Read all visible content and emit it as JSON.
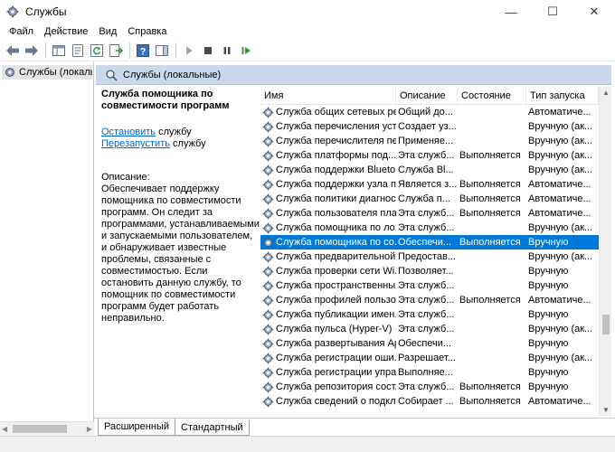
{
  "window": {
    "title": "Службы",
    "minimize_glyph": "—",
    "maximize_glyph": "☐",
    "close_glyph": "✕"
  },
  "menu": [
    "Файл",
    "Действие",
    "Вид",
    "Справка"
  ],
  "toolbar": {
    "icons": [
      "back-arrow-icon",
      "forward-arrow-icon",
      "console-tree-icon",
      "properties-icon",
      "refresh-icon",
      "export-list-icon",
      "help-icon",
      "show-hide-pane-icon",
      "play-icon",
      "stop-icon",
      "pause-icon",
      "restart-icon"
    ]
  },
  "tree": {
    "item_label": "Службы (локальны"
  },
  "panel": {
    "header": "Службы (локальные)",
    "selected_title": "Служба помощника по совместимости программ",
    "link_stop": "Остановить",
    "link_stop_suffix": " службу",
    "link_restart": "Перезапустить",
    "link_restart_suffix": " службу",
    "description_label": "Описание:",
    "description_text": "Обеспечивает поддержку помощника по совместимости программ. Он следит за программами, устанавливаемыми и запускаемыми пользователем, и обнаруживает известные проблемы, связанные с совместимостью. Если остановить данную службу, то помощник по совместимости программ будет работать неправильно."
  },
  "columns": {
    "name": "Имя",
    "description": "Описание",
    "state": "Состояние",
    "startup": "Тип запуска"
  },
  "services": [
    {
      "name": "Служба общих сетевых ре...",
      "desc": "Общий до...",
      "state": "",
      "start": "Автоматиче..."
    },
    {
      "name": "Служба перечисления уст...",
      "desc": "Создает уз...",
      "state": "",
      "start": "Вручную (ак..."
    },
    {
      "name": "Служба перечислителя пе...",
      "desc": "Применяе...",
      "state": "",
      "start": "Вручную (ак..."
    },
    {
      "name": "Служба платформы под...",
      "desc": "Эта служб...",
      "state": "Выполняется",
      "start": "Вручную (ак..."
    },
    {
      "name": "Служба поддержки Blueto...",
      "desc": "Служба Bl...",
      "state": "",
      "start": "Вручную (ак..."
    },
    {
      "name": "Служба поддержки узла п...",
      "desc": "Является з...",
      "state": "Выполняется",
      "start": "Автоматиче..."
    },
    {
      "name": "Служба политики диагнос...",
      "desc": "Служба п...",
      "state": "Выполняется",
      "start": "Автоматиче..."
    },
    {
      "name": "Служба пользователя пла...",
      "desc": "Эта служб...",
      "state": "Выполняется",
      "start": "Автоматиче..."
    },
    {
      "name": "Служба помощника по ло...",
      "desc": "Эта служб...",
      "state": "",
      "start": "Вручную (ак..."
    },
    {
      "name": "Служба помощника по со...",
      "desc": "Обеспечи...",
      "state": "Выполняется",
      "start": "Вручную",
      "selected": true
    },
    {
      "name": "Служба предварительной ...",
      "desc": "Предостав...",
      "state": "",
      "start": "Вручную (ак..."
    },
    {
      "name": "Служба проверки сети Wi...",
      "desc": "Позволяет...",
      "state": "",
      "start": "Вручную"
    },
    {
      "name": "Служба пространственны...",
      "desc": "Эта служб...",
      "state": "",
      "start": "Вручную"
    },
    {
      "name": "Служба профилей пользо...",
      "desc": "Эта служб...",
      "state": "Выполняется",
      "start": "Автоматиче..."
    },
    {
      "name": "Служба публикации имен...",
      "desc": "Эта служб...",
      "state": "",
      "start": "Вручную"
    },
    {
      "name": "Служба пульса (Hyper-V)",
      "desc": "Эта служб...",
      "state": "",
      "start": "Вручную (ак..."
    },
    {
      "name": "Служба развертывания Ap...",
      "desc": "Обеспечи...",
      "state": "",
      "start": "Вручную"
    },
    {
      "name": "Служба регистрации оши...",
      "desc": "Разрешает...",
      "state": "",
      "start": "Вручную (ак..."
    },
    {
      "name": "Служба регистрации упра...",
      "desc": "Выполняе...",
      "state": "",
      "start": "Вручную"
    },
    {
      "name": "Служба репозитория сост...",
      "desc": "Эта служб...",
      "state": "Выполняется",
      "start": "Вручную"
    },
    {
      "name": "Служба сведений о подкл...",
      "desc": "Собирает ...",
      "state": "Выполняется",
      "start": "Автоматиче..."
    }
  ],
  "tabs": [
    "Расширенный",
    "Стандартный"
  ]
}
